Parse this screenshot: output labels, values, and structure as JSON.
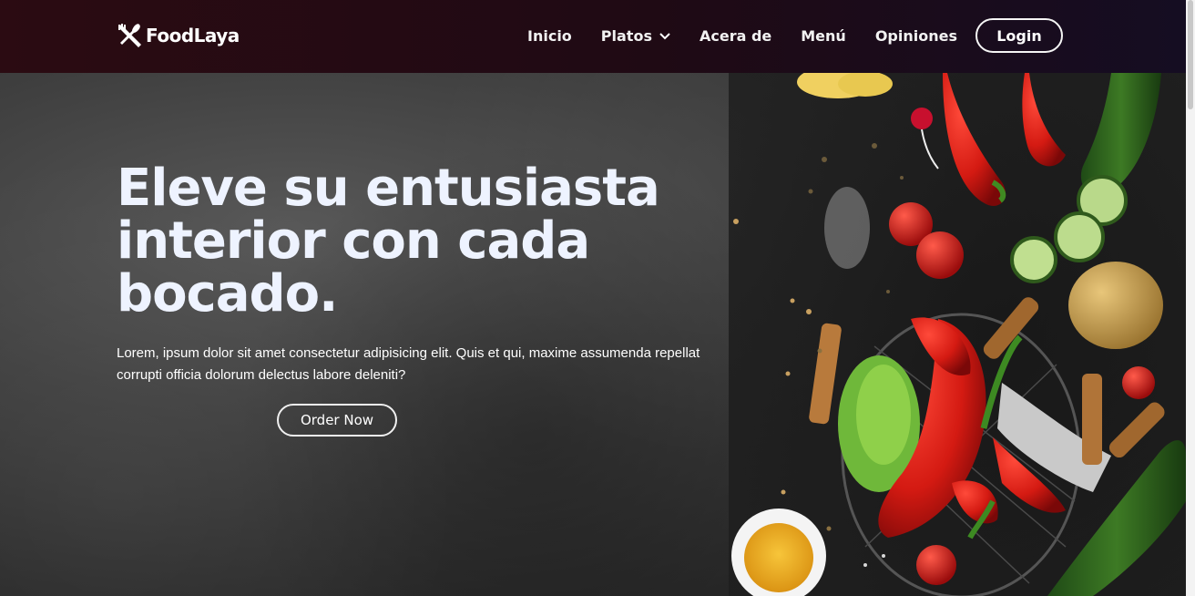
{
  "brand": {
    "name": "FoodLaya",
    "icon": "fork-knife-icon"
  },
  "nav": {
    "items": [
      {
        "label": "Inicio"
      },
      {
        "label": "Platos",
        "has_dropdown": true,
        "icon": "chevron-down-icon"
      },
      {
        "label": "Acera de"
      },
      {
        "label": "Menú"
      },
      {
        "label": "Opiniones"
      }
    ],
    "login_label": "Login"
  },
  "hero": {
    "title": "Eleve su entusiasta interior con cada bocado.",
    "text": "Lorem, ipsum dolor sit amet consectetur adipisicing elit. Quis et qui, maxime assumenda repellat corrupti officia dolorum delectus labore deleniti?",
    "order_label": "Order Now",
    "image": "vegetables-on-slate-image"
  },
  "colors": {
    "nav_bg": "#1f0a14",
    "title": "#eef3ff",
    "hero_bg": "#3a3a3a"
  }
}
